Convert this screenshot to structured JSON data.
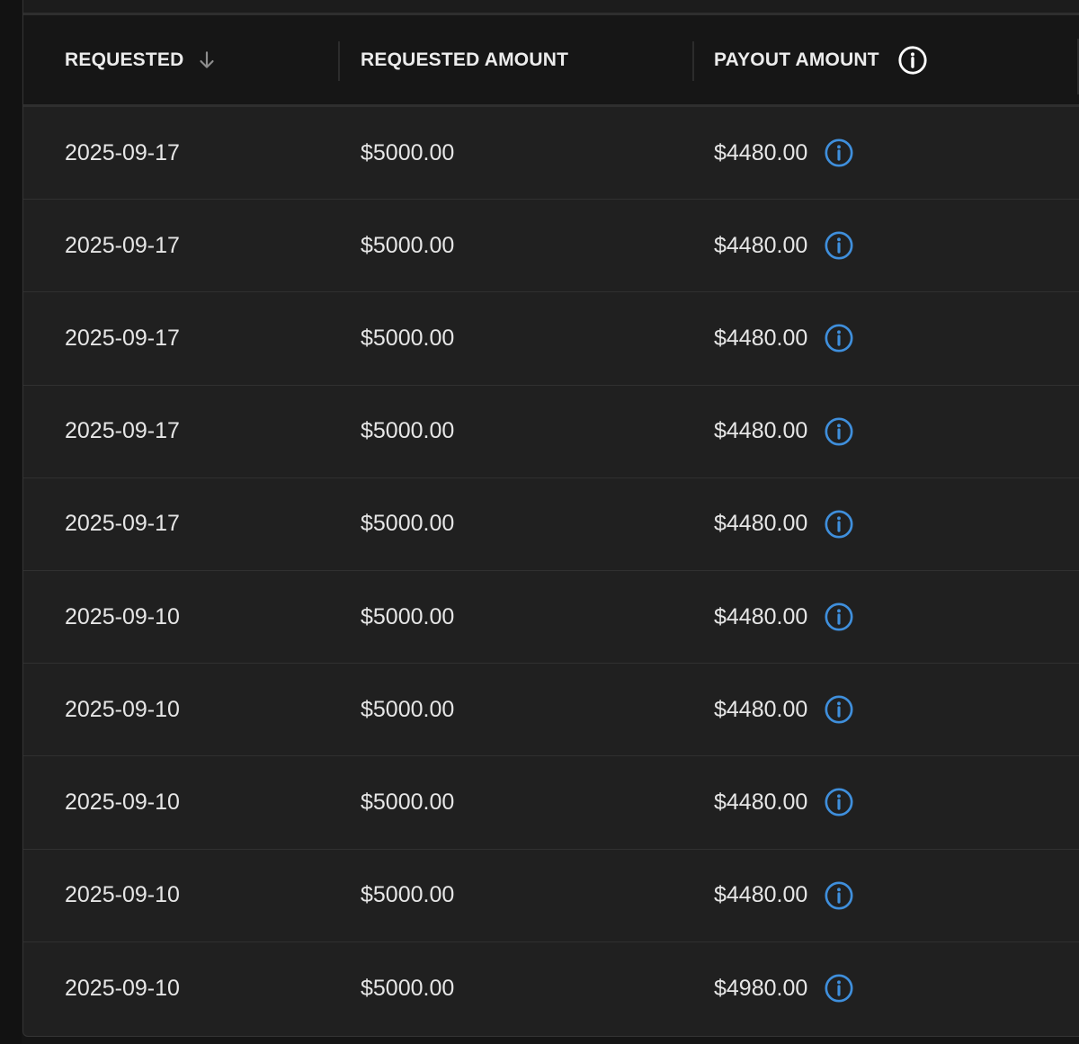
{
  "table": {
    "columns": [
      {
        "label": "REQUESTED",
        "sort": "descending",
        "icon": "arrow-down-icon"
      },
      {
        "label": "REQUESTED AMOUNT"
      },
      {
        "label": "PAYOUT AMOUNT",
        "icon": "info-icon"
      }
    ],
    "rows": [
      {
        "requested": "2025-09-17",
        "requested_amount": "$5000.00",
        "payout_amount": "$4480.00"
      },
      {
        "requested": "2025-09-17",
        "requested_amount": "$5000.00",
        "payout_amount": "$4480.00"
      },
      {
        "requested": "2025-09-17",
        "requested_amount": "$5000.00",
        "payout_amount": "$4480.00"
      },
      {
        "requested": "2025-09-17",
        "requested_amount": "$5000.00",
        "payout_amount": "$4480.00"
      },
      {
        "requested": "2025-09-17",
        "requested_amount": "$5000.00",
        "payout_amount": "$4480.00"
      },
      {
        "requested": "2025-09-10",
        "requested_amount": "$5000.00",
        "payout_amount": "$4480.00"
      },
      {
        "requested": "2025-09-10",
        "requested_amount": "$5000.00",
        "payout_amount": "$4480.00"
      },
      {
        "requested": "2025-09-10",
        "requested_amount": "$5000.00",
        "payout_amount": "$4480.00"
      },
      {
        "requested": "2025-09-10",
        "requested_amount": "$5000.00",
        "payout_amount": "$4480.00"
      },
      {
        "requested": "2025-09-10",
        "requested_amount": "$5000.00",
        "payout_amount": "$4980.00"
      }
    ]
  },
  "colors": {
    "background": "#202020",
    "header_background": "#161616",
    "text": "#e6e6e6",
    "info_icon_accent": "#3f8fdc"
  }
}
